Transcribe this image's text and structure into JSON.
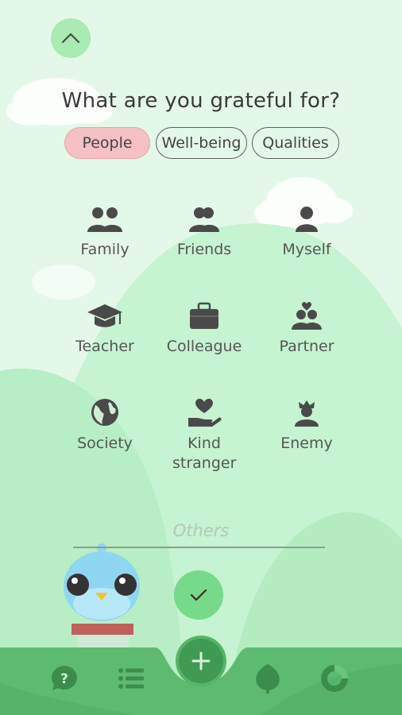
{
  "prompt": {
    "title": "What are you grateful for?"
  },
  "tabs": [
    {
      "label": "People",
      "active": true
    },
    {
      "label": "Well-being",
      "active": false
    },
    {
      "label": "Qualities",
      "active": false
    }
  ],
  "categories": [
    {
      "label": "Family",
      "icon": "family-icon"
    },
    {
      "label": "Friends",
      "icon": "friends-icon"
    },
    {
      "label": "Myself",
      "icon": "person-icon"
    },
    {
      "label": "Teacher",
      "icon": "graduation-cap-icon"
    },
    {
      "label": "Colleague",
      "icon": "briefcase-icon"
    },
    {
      "label": "Partner",
      "icon": "couple-heart-icon"
    },
    {
      "label": "Society",
      "icon": "globe-icon"
    },
    {
      "label": "Kind stranger",
      "icon": "heart-hand-icon"
    },
    {
      "label": "Enemy",
      "icon": "enemy-icon"
    }
  ],
  "others": {
    "placeholder": "Others"
  },
  "bottom_nav": {
    "items": [
      {
        "name": "help",
        "icon": "help-icon"
      },
      {
        "name": "list",
        "icon": "list-icon"
      },
      {
        "name": "add",
        "icon": "plus-icon"
      },
      {
        "name": "tree",
        "icon": "tree-icon"
      },
      {
        "name": "stats",
        "icon": "ring-chart-icon"
      }
    ]
  },
  "colors": {
    "background": "#e4f8ea",
    "hill": "#c3f2cf",
    "active_chip": "#f6c1c4",
    "confirm": "#77d98a",
    "nav_bar": "#5dbb71",
    "icon": "#4a4a4a"
  }
}
